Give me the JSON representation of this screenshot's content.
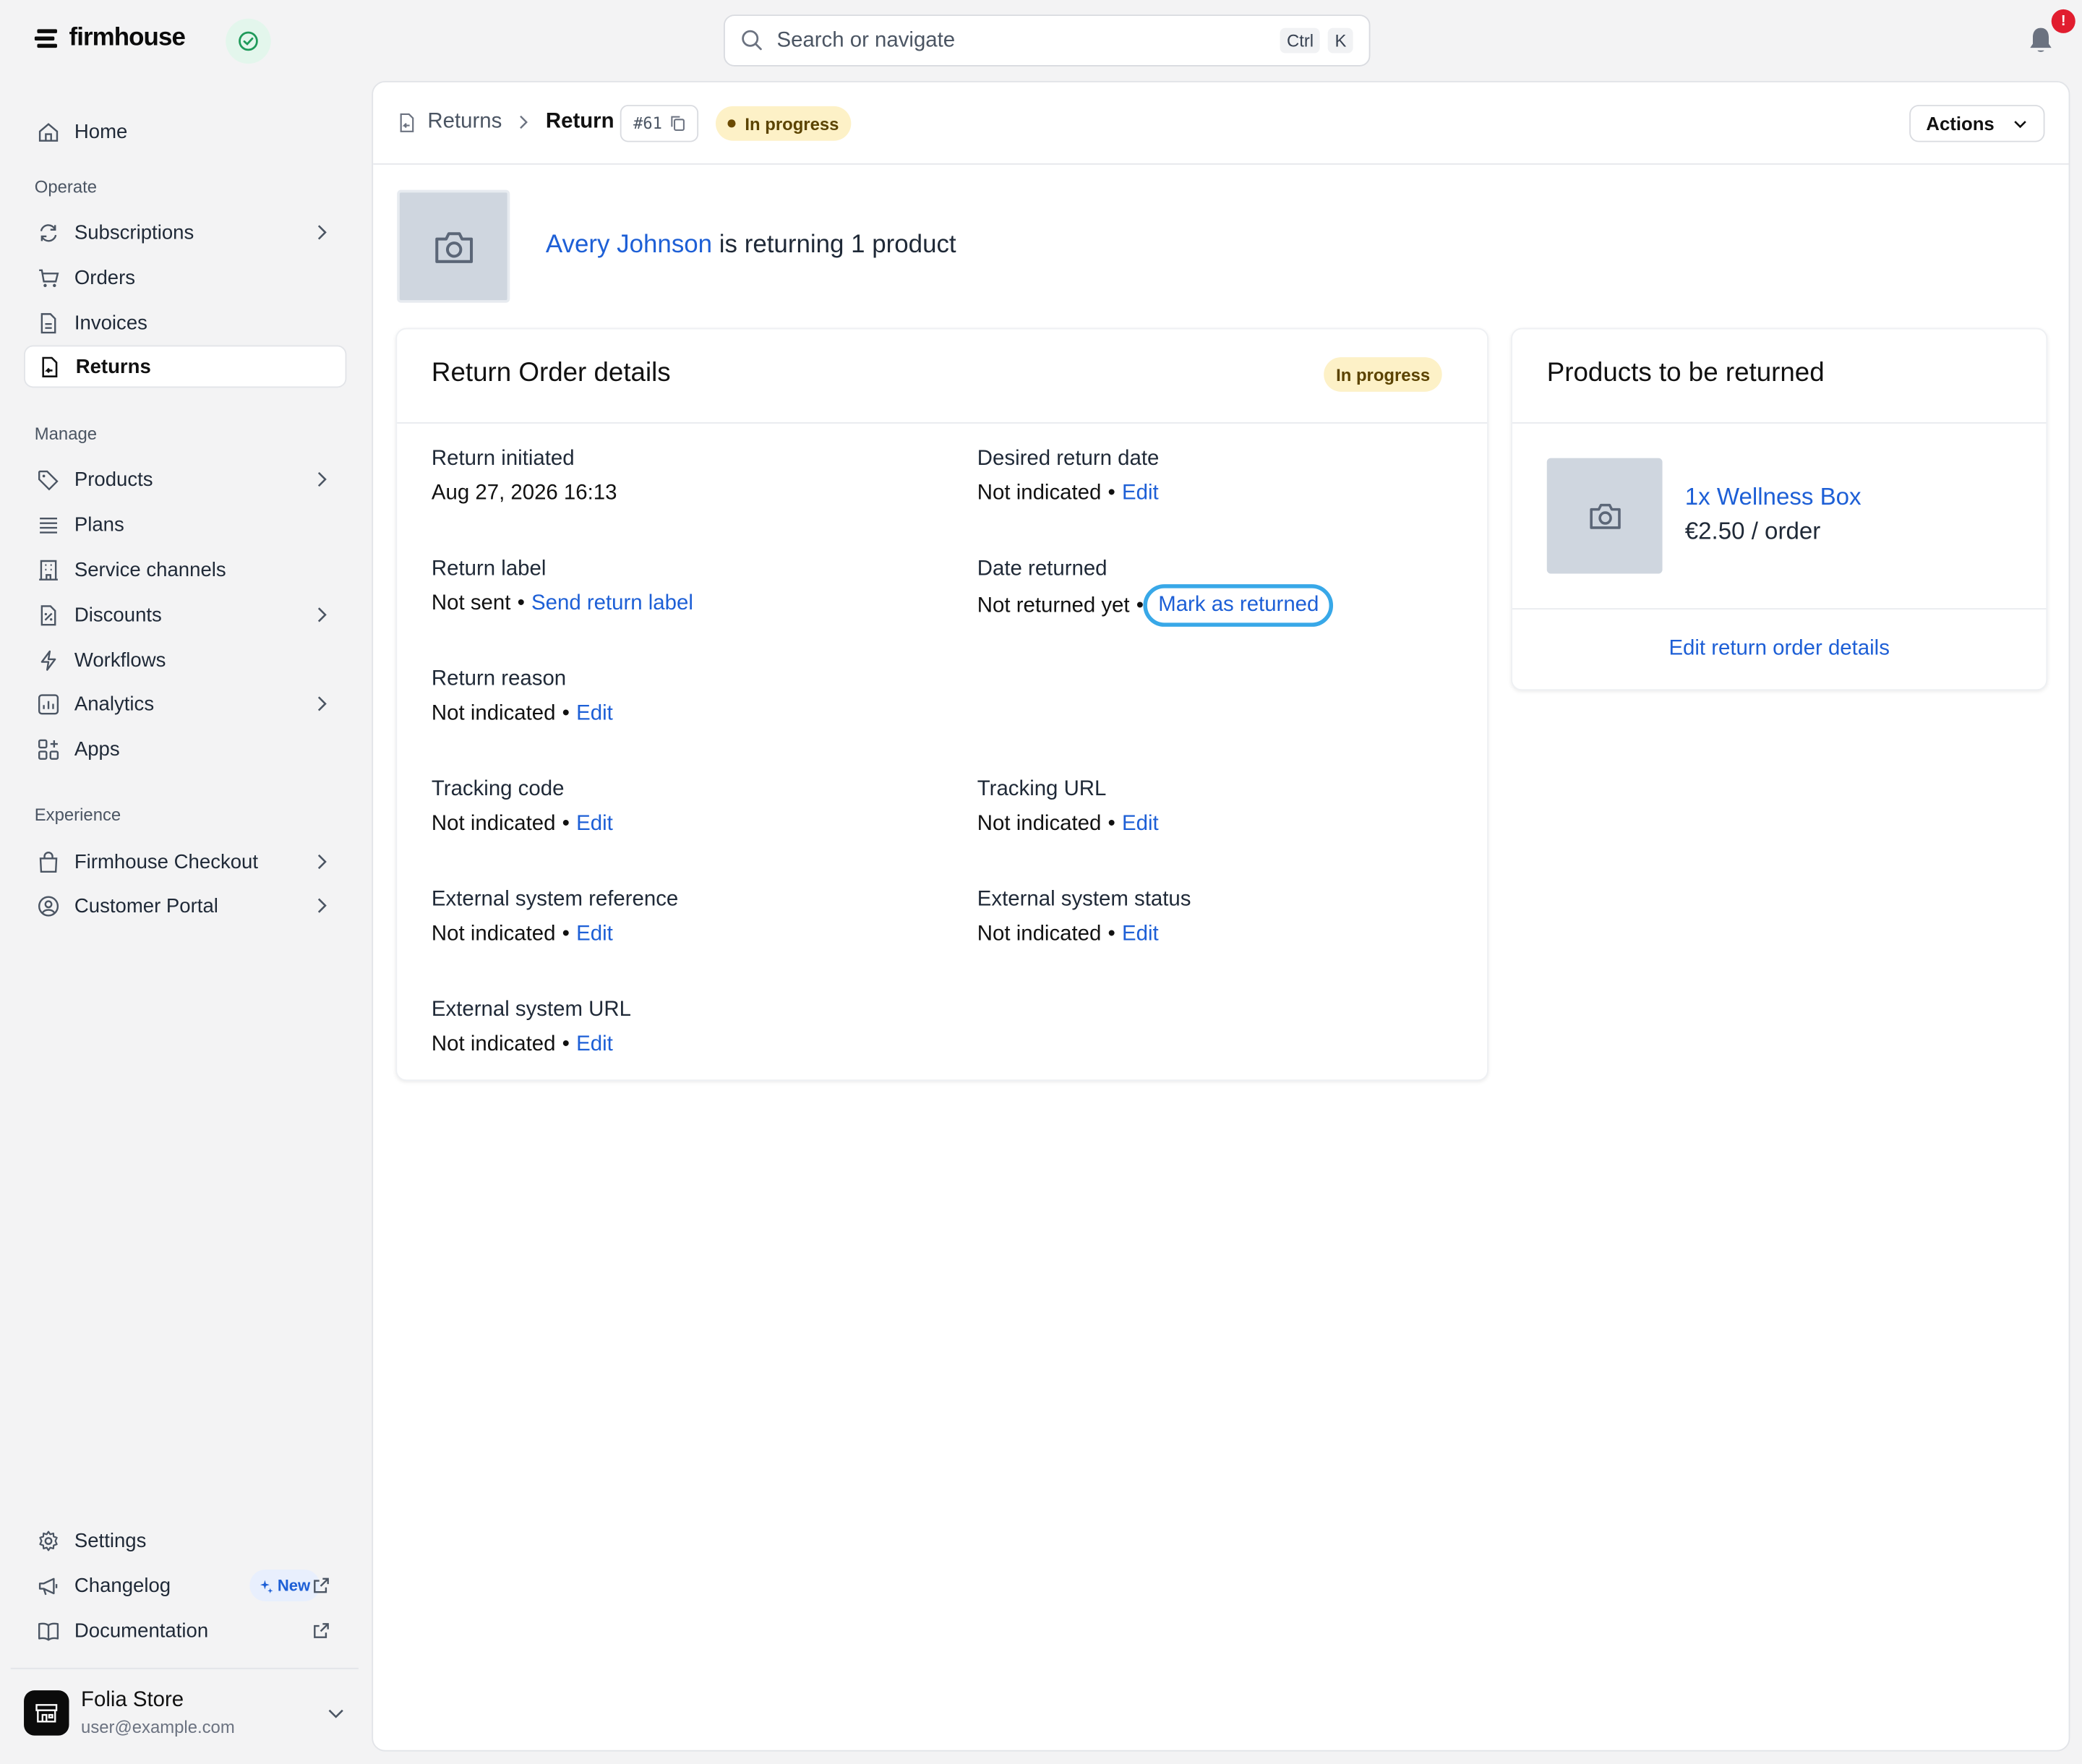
{
  "app": {
    "brand": "firmhouse",
    "search_placeholder": "Search or navigate",
    "search_kbd_1": "Ctrl",
    "search_kbd_2": "K",
    "notification_count": "!"
  },
  "sidebar": {
    "home": "Home",
    "section_operate": "Operate",
    "subscriptions": "Subscriptions",
    "orders": "Orders",
    "invoices": "Invoices",
    "returns": "Returns",
    "section_manage": "Manage",
    "products": "Products",
    "plans": "Plans",
    "service_channels": "Service channels",
    "discounts": "Discounts",
    "workflows": "Workflows",
    "analytics": "Analytics",
    "apps": "Apps",
    "section_experience": "Experience",
    "firmhouse_checkout": "Firmhouse Checkout",
    "customer_portal": "Customer Portal",
    "settings": "Settings",
    "changelog": "Changelog",
    "changelog_badge": "New",
    "documentation": "Documentation",
    "store_name": "Folia Store",
    "store_email": "user@example.com"
  },
  "header": {
    "breadcrumb_parent": "Returns",
    "breadcrumb_current": "Return",
    "return_id": "#61",
    "status": "In progress",
    "actions_label": "Actions"
  },
  "summary": {
    "customer_name": "Avery Johnson",
    "summary_text": " is returning 1 product"
  },
  "return_details": {
    "title": "Return Order details",
    "status": "In progress",
    "bullet": "•",
    "edit_label": "Edit",
    "return_initiated_label": "Return initiated",
    "return_initiated_value": "Aug 27, 2026 16:13",
    "desired_return_date_label": "Desired return date",
    "desired_return_date_value": "Not indicated",
    "return_label_label": "Return label",
    "return_label_value": "Not sent",
    "send_return_label": "Send return label",
    "date_returned_label": "Date returned",
    "date_returned_value": "Not returned yet",
    "mark_as_returned": "Mark as returned",
    "return_reason_label": "Return reason",
    "return_reason_value": "Not indicated",
    "tracking_code_label": "Tracking code",
    "tracking_code_value": "Not indicated",
    "tracking_url_label": "Tracking URL",
    "tracking_url_value": "Not indicated",
    "external_reference_label": "External system reference",
    "external_reference_value": "Not indicated",
    "external_status_label": "External system status",
    "external_status_value": "Not indicated",
    "external_url_label": "External system URL",
    "external_url_value": "Not indicated"
  },
  "products_card": {
    "title": "Products to be returned",
    "product_name": "1x Wellness Box",
    "product_price": "€2.50 / order",
    "edit_details": "Edit return order details"
  },
  "colors": {
    "link": "#1d5fd6",
    "status_bg": "#fdf1c7",
    "focus_ring": "#38a8e8",
    "badge_red": "#e11d2f"
  }
}
